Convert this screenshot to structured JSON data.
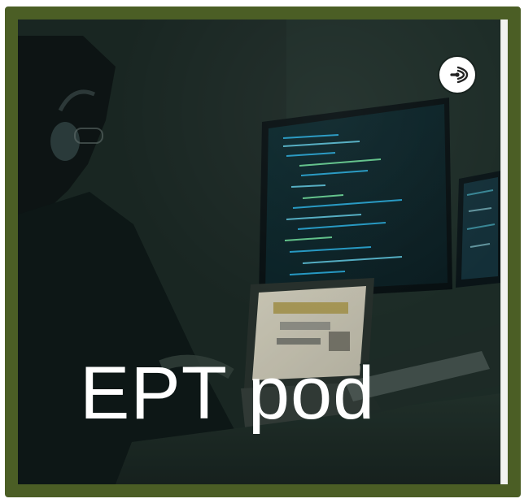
{
  "artwork": {
    "title": "EPT pod",
    "badge_icon": "podcast-icon",
    "colors": {
      "frame": "#4b5e25",
      "text": "#ffffff",
      "badge": "#ffffff"
    }
  }
}
